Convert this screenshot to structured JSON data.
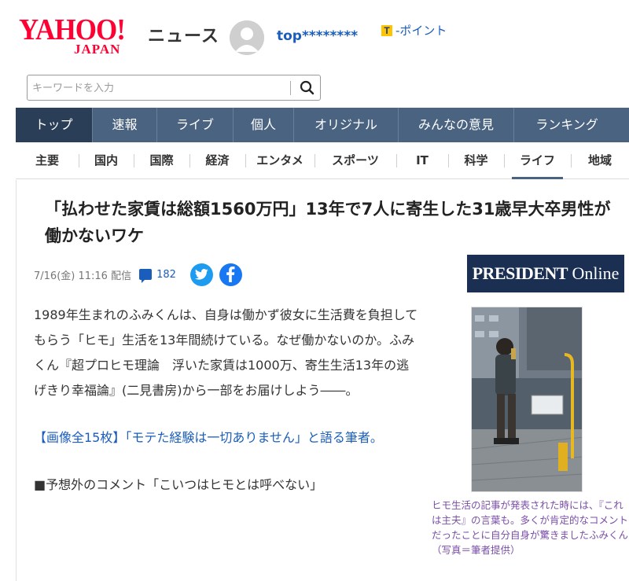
{
  "header": {
    "logo_main": "YAHOO!",
    "logo_sub": "JAPAN",
    "logo_section": "ニュース",
    "username": "top********",
    "tpoint_icon": "T",
    "tpoint_label": "-ポイント"
  },
  "search": {
    "placeholder": "キーワードを入力",
    "button_icon": "search-icon"
  },
  "main_nav": {
    "items": [
      {
        "label": "トップ",
        "active": true
      },
      {
        "label": "速報"
      },
      {
        "label": "ライブ"
      },
      {
        "label": "個人"
      },
      {
        "label": "オリジナル"
      },
      {
        "label": "みんなの意見"
      },
      {
        "label": "ランキング"
      }
    ]
  },
  "sub_nav": {
    "items": [
      {
        "label": "主要"
      },
      {
        "label": "国内"
      },
      {
        "label": "国際"
      },
      {
        "label": "経済"
      },
      {
        "label": "エンタメ"
      },
      {
        "label": "スポーツ"
      },
      {
        "label": "IT"
      },
      {
        "label": "科学"
      },
      {
        "label": "ライフ",
        "active": true
      },
      {
        "label": "地域"
      }
    ]
  },
  "article": {
    "title": "「払わせた家賃は総額1560万円」13年で7人に寄生した31歳早大卒男性が働かないワケ",
    "date": "7/16(金) 11:16 配信",
    "comment_count": "182",
    "publisher_bold": "PRESIDENT",
    "publisher_light": "Online",
    "body": "1989年生まれのふみくんは、自身は働かず彼女に生活費を負担してもらう「ヒモ」生活を13年間続けている。なぜ働かないのか。ふみくん『超プロヒモ理論　浮いた家賃は1000万、寄生生活13年の逃げきり幸福論』(二見書房)から一部をお届けしよう――。",
    "gallery_link": "【画像全15枚】「モテた経験は一切ありません」と語る筆者。",
    "section_heading": "■予想外のコメント「こいつはヒモとは呼べない」",
    "photo_caption": "ヒモ生活の記事が発表された時には、『これは主夫』の言葉も。多くが肯定的なコメントだったことに自分自身が驚きましたふみくん（写真＝筆者提供）"
  },
  "colors": {
    "brand_red": "#ff0033",
    "nav_bg": "#4a6380",
    "nav_active": "#2a3f57",
    "link_blue": "#1a5dbb",
    "caption_purple": "#7a4fa8"
  }
}
